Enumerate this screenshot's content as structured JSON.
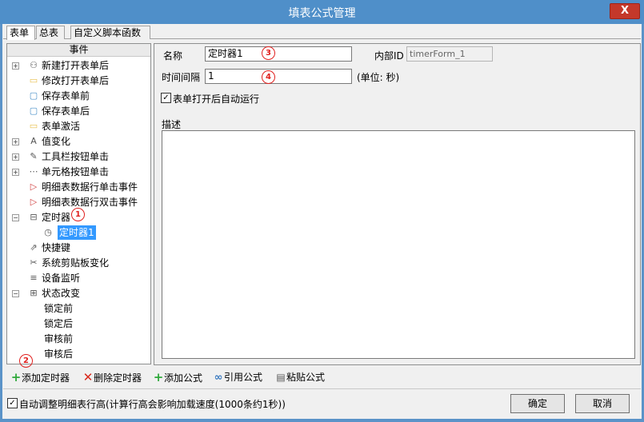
{
  "window": {
    "title": "填表公式管理",
    "close_label": "X"
  },
  "tabs": [
    {
      "label": "表单"
    },
    {
      "label": "总表"
    },
    {
      "label": "自定义脚本函数"
    }
  ],
  "tree": {
    "header": "事件",
    "items": [
      {
        "label": "新建打开表单后",
        "icon": "user-add-icon",
        "glyph": "⚇",
        "expandable": true,
        "depth": 0
      },
      {
        "label": "修改打开表单后",
        "icon": "folder-icon",
        "glyph": "▭",
        "expandable": false,
        "depth": 0
      },
      {
        "label": "保存表单前",
        "icon": "save-icon",
        "glyph": "▢",
        "expandable": false,
        "depth": 0
      },
      {
        "label": "保存表单后",
        "icon": "save-icon",
        "glyph": "▢",
        "expandable": false,
        "depth": 0
      },
      {
        "label": "表单激活",
        "icon": "folder-icon",
        "glyph": "▭",
        "expandable": false,
        "depth": 0
      },
      {
        "label": "值变化",
        "icon": "value-icon",
        "glyph": "A",
        "expandable": true,
        "depth": 0
      },
      {
        "label": "工具栏按钮单击",
        "icon": "wrench-icon",
        "glyph": "✎",
        "expandable": true,
        "depth": 0
      },
      {
        "label": "单元格按钮单击",
        "icon": "dots-icon",
        "glyph": "⋯",
        "expandable": true,
        "depth": 0
      },
      {
        "label": "明细表数据行单击事件",
        "icon": "flag-icon",
        "glyph": "▷",
        "expandable": false,
        "depth": 0
      },
      {
        "label": "明细表数据行双击事件",
        "icon": "flag-icon",
        "glyph": "▷",
        "expandable": false,
        "depth": 0
      },
      {
        "label": "定时器",
        "icon": "timer-icon",
        "glyph": "⊟",
        "expandable": true,
        "expanded": true,
        "depth": 0
      },
      {
        "label": "定时器1",
        "icon": "clock-icon",
        "glyph": "◷",
        "expandable": false,
        "depth": 1,
        "selected": true
      },
      {
        "label": "快捷键",
        "icon": "shortcut-icon",
        "glyph": "⇗",
        "expandable": false,
        "depth": 0
      },
      {
        "label": "系统剪贴板变化",
        "icon": "scissors-icon",
        "glyph": "✂",
        "expandable": false,
        "depth": 0
      },
      {
        "label": "设备监听",
        "icon": "database-icon",
        "glyph": "≡",
        "expandable": false,
        "depth": 0
      },
      {
        "label": "状态改变",
        "icon": "status-icon",
        "glyph": "⊞",
        "expandable": true,
        "expanded": true,
        "depth": 0
      },
      {
        "label": "锁定前",
        "icon": "",
        "glyph": "",
        "expandable": false,
        "depth": 1
      },
      {
        "label": "锁定后",
        "icon": "",
        "glyph": "",
        "expandable": false,
        "depth": 1
      },
      {
        "label": "审核前",
        "icon": "",
        "glyph": "",
        "expandable": false,
        "depth": 1
      },
      {
        "label": "审核后",
        "icon": "",
        "glyph": "",
        "expandable": false,
        "depth": 1
      }
    ]
  },
  "form": {
    "name_label": "名称",
    "name_value": "定时器1",
    "internal_id_label": "内部ID",
    "internal_id_value": "timerForm_1",
    "interval_label": "时间间隔",
    "interval_value": "1",
    "interval_unit": "(单位: 秒)",
    "autorun_label": "表单打开后自动运行",
    "autorun_checked": true,
    "description_label": "描述",
    "description_value": ""
  },
  "markers": {
    "m1": "1",
    "m2": "2",
    "m3": "3",
    "m4": "4"
  },
  "toolbar": {
    "add_timer": "添加定时器",
    "delete_timer": "删除定时器",
    "add_formula": "添加公式",
    "ref_formula": "引用公式",
    "paste_formula": "粘贴公式"
  },
  "footer": {
    "autoheight_label": "自动调整明细表行高(计算行高会影响加载速度(1000条约1秒))",
    "autoheight_checked": true,
    "ok_label": "确定",
    "cancel_label": "取消"
  },
  "colors": {
    "titlebar": "#4f8fc9",
    "close_button": "#c4382a",
    "selection": "#3399ff",
    "marker": "#e0201e",
    "add_icon": "#2ea83a",
    "delete_icon": "#d8281c"
  }
}
